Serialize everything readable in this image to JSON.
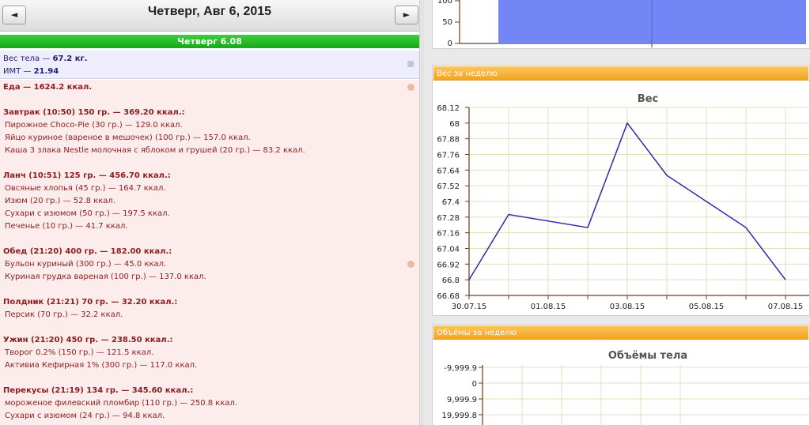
{
  "header": {
    "prev_icon": "◄",
    "next_icon": "►",
    "date_title": "Четверг, Авг 6, 2015",
    "day_label": "Четверг 6.08"
  },
  "weight_box": {
    "weight_label": "Вес тела — ",
    "weight_value": "67.2 кг.",
    "bmi_label": "ИМТ — ",
    "bmi_value": "21.94"
  },
  "food": {
    "total": "Еда — 1624.2 ккал.",
    "lines": [
      {
        "kind": "meal",
        "text": "Завтрак (10:50) 150 гр. — 369.20 ккал.:"
      },
      {
        "kind": "item",
        "text": "Пирожное Choco-Pie (30 гр.) — 129.0 ккал."
      },
      {
        "kind": "item",
        "text": "Яйцо куриное (вареное в мешочек) (100 гр.) — 157.0 ккал."
      },
      {
        "kind": "item",
        "text": "Каша 3 злака Nestle молочная с яблоком и грушей (20 гр.) — 83.2 ккал."
      },
      {
        "kind": "meal",
        "text": "Ланч (10:51) 125 гр. — 456.70 ккал.:"
      },
      {
        "kind": "item",
        "text": "Овсяные хлопья (45 гр.) — 164.7 ккал."
      },
      {
        "kind": "item",
        "text": "Изюм (20 гр.) — 52.8 ккал."
      },
      {
        "kind": "item",
        "text": "Сухари с изюмом (50 гр.) — 197.5 ккал."
      },
      {
        "kind": "item",
        "text": "Печенье (10 гр.) — 41.7 ккал."
      },
      {
        "kind": "meal",
        "text": "Обед (21:20) 400 гр. — 182.00 ккал.:"
      },
      {
        "kind": "item",
        "text": "Бульон куриный (300 гр.) — 45.0 ккал."
      },
      {
        "kind": "item",
        "text": "Куриная грудка вареная (100 гр.) — 137.0 ккал."
      },
      {
        "kind": "meal",
        "text": "Полдник (21:21) 70 гр. — 32.20 ккал.:"
      },
      {
        "kind": "item",
        "text": "Персик (70 гр.) — 32.2 ккал."
      },
      {
        "kind": "meal",
        "text": "Ужин (21:20) 450 гр. — 238.50 ккал.:"
      },
      {
        "kind": "item",
        "text": "Творог 0.2% (150 гр.) — 121.5 ккал."
      },
      {
        "kind": "item",
        "text": "Активиа Кефирная 1% (300 гр.) — 117.0 ккал."
      },
      {
        "kind": "meal",
        "text": "Перекусы (21:19) 134 гр. — 345.60 ккал.:"
      },
      {
        "kind": "item",
        "text": "мороженое филевский пломбир (110 гр.) — 250.8 ккал."
      },
      {
        "kind": "item",
        "text": "Сухари с изюмом (24 гр.) — 94.8 ккал."
      }
    ]
  },
  "panels": {
    "weight_title": "Вес за неделю",
    "volume_title": "Объёмы за неделю"
  },
  "colors": {
    "day_bar": "#1fb51f",
    "panel_header": "#f6a92b",
    "weight_line": "#2a2aa6",
    "bar_fill": "#7486f5"
  },
  "chart_data": [
    {
      "type": "bar",
      "ytick_labels": [
        "100",
        "50",
        "0"
      ],
      "ylim": [
        0,
        100
      ],
      "series_color": "#7486f5",
      "note_visible": "partial chart, cropped at top"
    },
    {
      "type": "line",
      "title": "Вес",
      "x": [
        "30.07.15",
        "31.07.15",
        "01.08.15",
        "02.08.15",
        "03.08.15",
        "04.08.15",
        "05.08.15",
        "06.08.15",
        "07.08.15"
      ],
      "xtick_labels": [
        "30.07.15",
        "01.08.15",
        "03.08.15",
        "05.08.15",
        "07.08.15"
      ],
      "values": [
        66.8,
        67.3,
        null,
        67.2,
        68.0,
        67.6,
        null,
        67.2,
        66.8
      ],
      "yticks": [
        "68.12",
        "68",
        "67.88",
        "67.76",
        "67.64",
        "67.52",
        "67.4",
        "67.28",
        "67.16",
        "67.04",
        "66.92",
        "66.8",
        "66.68"
      ],
      "ylim": [
        66.68,
        68.12
      ],
      "grid": true
    },
    {
      "type": "line",
      "title": "Объёмы тела",
      "yticks": [
        "-9,999.9",
        "0",
        "9,999.9",
        "19,999.8"
      ],
      "grid": true
    }
  ]
}
